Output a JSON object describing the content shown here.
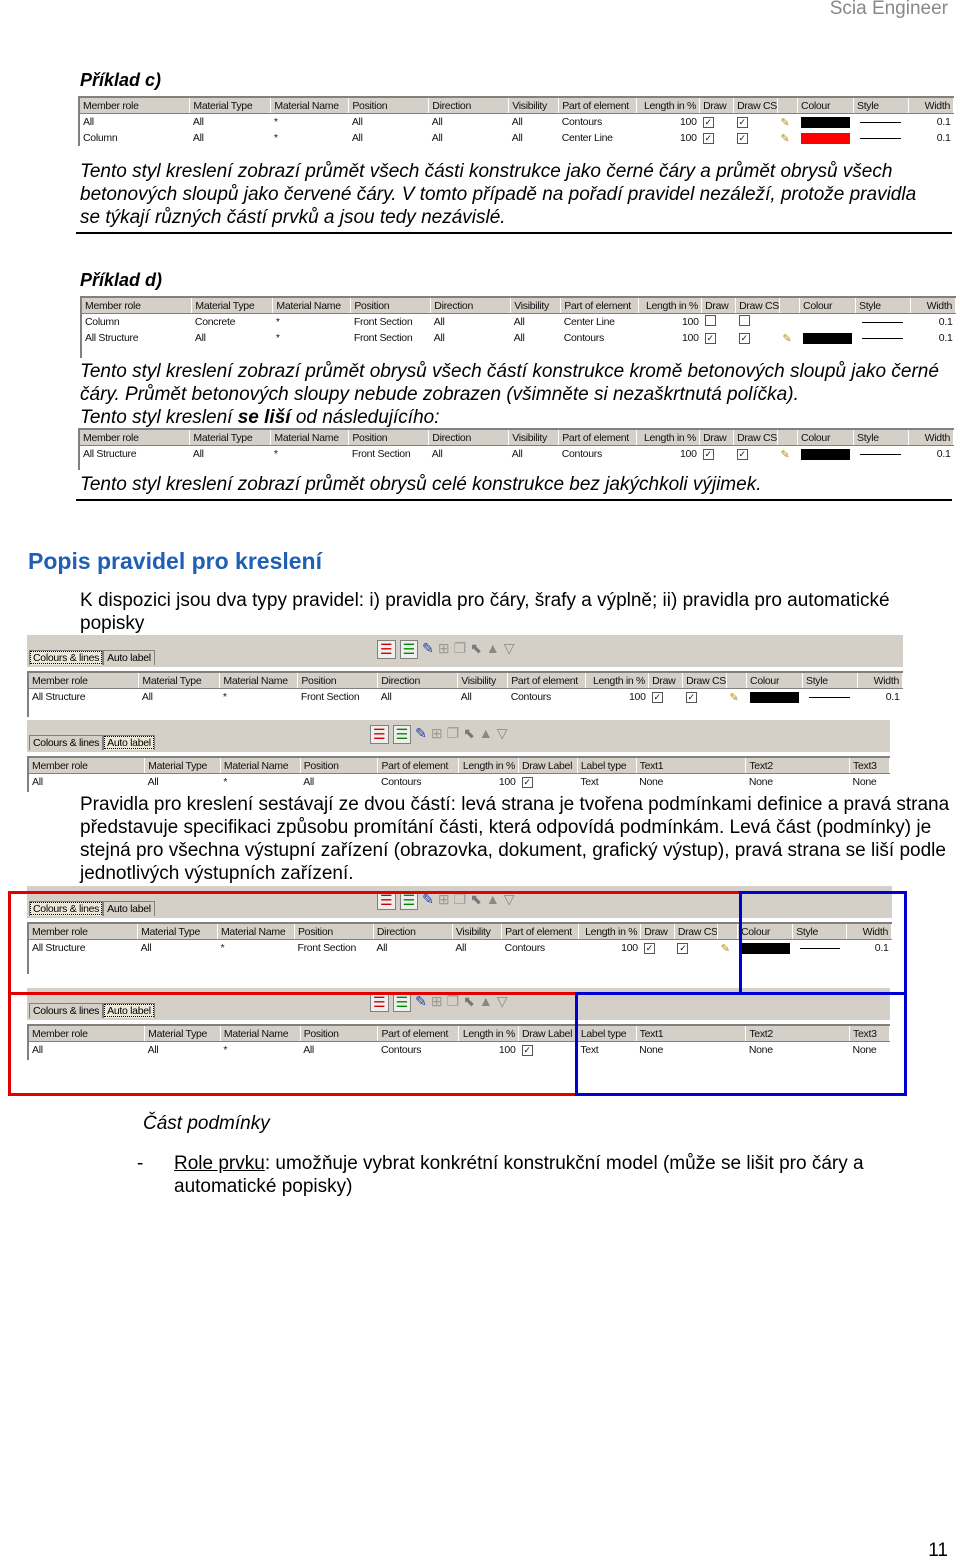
{
  "header": {
    "app_name": "Scia Engineer"
  },
  "colors": {
    "heading": "#1f5fb4",
    "red_box": "#e00000",
    "blue_box": "#0000d0",
    "black": "#000000",
    "red": "#ff0000"
  },
  "example_c": {
    "title": "Příklad c)",
    "text": "Tento styl kreslení zobrazí průmět všech části konstrukce jako černé čáry a průmět obrysů všech betonových sloupů jako červené čáry. V tomto případě na pořadí pravidel nezáleží, protože pravidla se týkají různých částí prvků a jsou tedy nezávislé."
  },
  "example_d": {
    "title": "Příklad d)",
    "text1": "Tento styl kreslení zobrazí průmět obrysů všech částí konstrukce kromě betonových sloupů jako černé čáry. Průmět betonových sloupy nebude zobrazen (všimněte si nezaškrtnutá políčka).",
    "text2_a": "Tento styl kreslení ",
    "text2_b": "se liší",
    "text2_c": " od následujícího:",
    "text3": "Tento styl kreslení zobrazí průmět obrysů celé konstrukce bez jakýchkoli výjimek."
  },
  "section": {
    "heading": "Popis pravidel pro kreslení",
    "para1": "K dispozici jsou dva typy pravidel: i) pravidla pro čáry, šrafy a výplně; ii) pravidla pro automatické popisky",
    "para2": "Pravidla pro kreslení sestávají ze dvou částí: levá strana je tvořena podmínkami definice a pravá strana představuje specifikaci způsobu promítání části, která odpovídá podmínkám. Levá část (podmínky) je stejná pro všechna výstupní zařízení (obrazovka, dokument, grafický výstup), pravá strana se liší podle jednotlivých výstupních zařízení.",
    "subheading": "Část podmínky",
    "bullet_dash": "-",
    "bullet_link": "Role prvku",
    "bullet_text": ": umožňuje vybrat konkrétní konstrukční model (může se lišit pro čáry a automatické popisky)"
  },
  "tabs": {
    "colours_lines": "Colours & lines",
    "auto_label": "Auto label"
  },
  "toolbar_icons": [
    "add-rule-icon",
    "remove-rule-icon",
    "edit-icon",
    "tree-icon",
    "copy-icon",
    "select-icon",
    "move-up-icon",
    "move-down-icon"
  ],
  "lines_columns": [
    "Member role",
    "Material Type",
    "Material Name",
    "Position",
    "Direction",
    "Visibility",
    "Part of element",
    "Length in %",
    "Draw",
    "Draw CS",
    "",
    "Colour",
    "Style",
    "Width"
  ],
  "label_columns": [
    "Member role",
    "Material Type",
    "Material Name",
    "Position",
    "Part of element",
    "Length in %",
    "Draw Label",
    "Label type",
    "Text1",
    "Text2",
    "Text3"
  ],
  "table_c": [
    [
      "All",
      "All",
      "*",
      "All",
      "All",
      "All",
      "Contours",
      "100",
      true,
      true,
      "pencil",
      "#000000",
      "line",
      "0.1"
    ],
    [
      "Column",
      "All",
      "*",
      "All",
      "All",
      "All",
      "Center Line",
      "100",
      true,
      true,
      "pencil",
      "#ff0000",
      "line",
      "0.1"
    ]
  ],
  "table_d": [
    [
      "Column",
      "Concrete",
      "*",
      "Front Section",
      "All",
      "All",
      "Center Line",
      "100",
      false,
      false,
      "",
      "",
      "line",
      "0.1"
    ],
    [
      "All Structure",
      "All",
      "*",
      "Front Section",
      "All",
      "All",
      "Contours",
      "100",
      true,
      true,
      "pencil",
      "#000000",
      "line",
      "0.1"
    ]
  ],
  "table_d2": [
    [
      "All Structure",
      "All",
      "*",
      "Front Section",
      "All",
      "All",
      "Contours",
      "100",
      true,
      true,
      "pencil",
      "#000000",
      "line",
      "0.1"
    ]
  ],
  "screen_lines": [
    [
      "All Structure",
      "All",
      "*",
      "Front Section",
      "All",
      "All",
      "Contours",
      "100",
      true,
      true,
      "pencil",
      "#000000",
      "line",
      "0.1"
    ]
  ],
  "screen_label": [
    [
      "All",
      "All",
      "*",
      "All",
      "Contours",
      "100",
      true,
      "Text",
      "None",
      "None",
      "None"
    ]
  ],
  "page_number": "11"
}
